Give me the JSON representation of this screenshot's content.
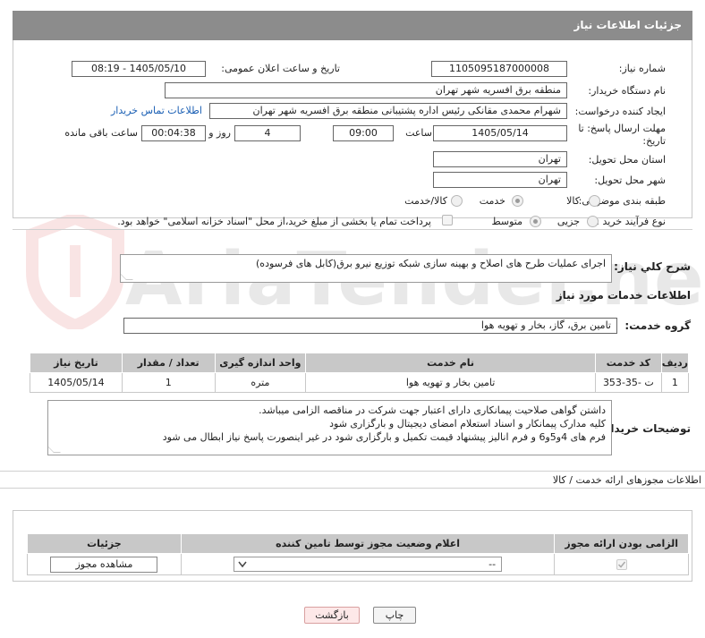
{
  "panel_title": "جزئیات اطلاعات نیاز",
  "fields": {
    "need_number_label": "شماره نیاز:",
    "need_number": "1105095187000008",
    "announce_label": "تاریخ و ساعت اعلان عمومی:",
    "announce_value": "1405/05/10 - 08:19",
    "buyer_org_label": "نام دستگاه خریدار:",
    "buyer_org": "منطقه برق افسریه شهر تهران",
    "creator_label": "ایجاد کننده درخواست:",
    "creator": "شهرام محمدی مقانکی رئیس اداره پشتیبانی منطقه برق افسریه شهر تهران",
    "contact_link": "اطلاعات تماس خریدار",
    "deadline_label_1": "مهلت ارسال پاسخ: تا",
    "deadline_label_2": "تاریخ:",
    "deadline_date": "1405/05/14",
    "time_label": "ساعت",
    "deadline_time": "09:00",
    "days_value": "4",
    "days_label": "روز و",
    "remaining_value": "00:04:38",
    "remaining_label": "ساعت باقی مانده",
    "province_label": "استان محل تحویل:",
    "province": "تهران",
    "city_label": "شهر محل تحویل:",
    "city": "تهران",
    "category_label": "طبقه بندی موضوعی:",
    "category_options": [
      "کالا",
      "خدمت",
      "کالا/خدمت"
    ],
    "purchase_type_label": "نوع فرآیند خرید :",
    "purchase_options": [
      "جزیی",
      "متوسط"
    ],
    "payment_note": "پرداخت تمام یا بخشی از مبلغ خرید،از محل \"اسناد خزانه اسلامی\" خواهد بود."
  },
  "summary": {
    "label": "شرح کلي نياز:",
    "text": "اجرای عملیات طرح های اصلاح و بهینه سازی شبکه توزیع نیرو برق(کابل های فرسوده)"
  },
  "services_section_title": "اطلاعات خدمات مورد نیاز",
  "service_group": {
    "label": "گروه خدمت:",
    "value": "تامین برق، گاز، بخار و تهویه هوا"
  },
  "services_table": {
    "headers": [
      "ردیف",
      "کد خدمت",
      "نام خدمت",
      "واحد اندازه گیری",
      "تعداد / مقدار",
      "تاریخ نیاز"
    ],
    "rows": [
      [
        "1",
        "ت -35-353",
        "تامین بخار و تهویه هوا",
        "متره",
        "1",
        "1405/05/14"
      ]
    ]
  },
  "buyer_notes": {
    "label": "توضیحات خریدار:",
    "lines": [
      "داشتن گواهی صلاحیت پیمانکاری دارای اعتبار جهت شرکت در مناقصه الزامی میباشد.",
      "کلیه مدارک پیمانکار و اسناد استعلام امضای دیجیتال و بارگزاری شود",
      "فرم های 4و5و6 و فرم انالیز پیشنهاد قیمت تکمیل و بارگزاری شود در غیر اینصورت پاسخ نیاز ابطال می شود"
    ]
  },
  "permits": {
    "title": "اطلاعات مجوزهای ارائه خدمت / کالا",
    "headers": [
      "الزامی بودن ارائه مجوز",
      "اعلام وضعیت مجوز توسط تامین کننده",
      "جزئیات"
    ],
    "select_value": "--",
    "view_button": "مشاهده مجوز"
  },
  "buttons": {
    "print": "چاپ",
    "back": "بازگشت"
  },
  "watermark": "AriaTender.net"
}
